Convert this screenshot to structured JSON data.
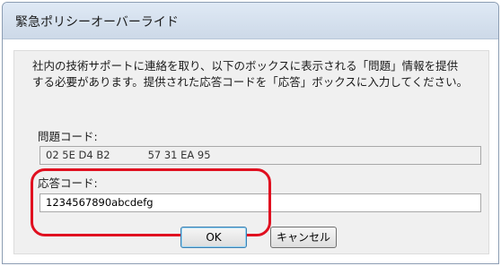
{
  "window": {
    "title": "緊急ポリシーオーバーライド"
  },
  "message": {
    "line1": "社内の技術サポートに連絡を取り、以下のボックスに表示される「問題」情報を提供",
    "line2": "する必要があります。提供された応答コードを「応答」ボックスに入力してください。"
  },
  "problem": {
    "label": "問題コード:",
    "code_part1": "02 5E D4 B2",
    "code_part2": "57 31 EA 95"
  },
  "response": {
    "label": "応答コード:",
    "value": "1234567890abcdefg"
  },
  "buttons": {
    "ok": "OK",
    "cancel": "キャンセル"
  },
  "colors": {
    "highlight": "#e01020"
  }
}
